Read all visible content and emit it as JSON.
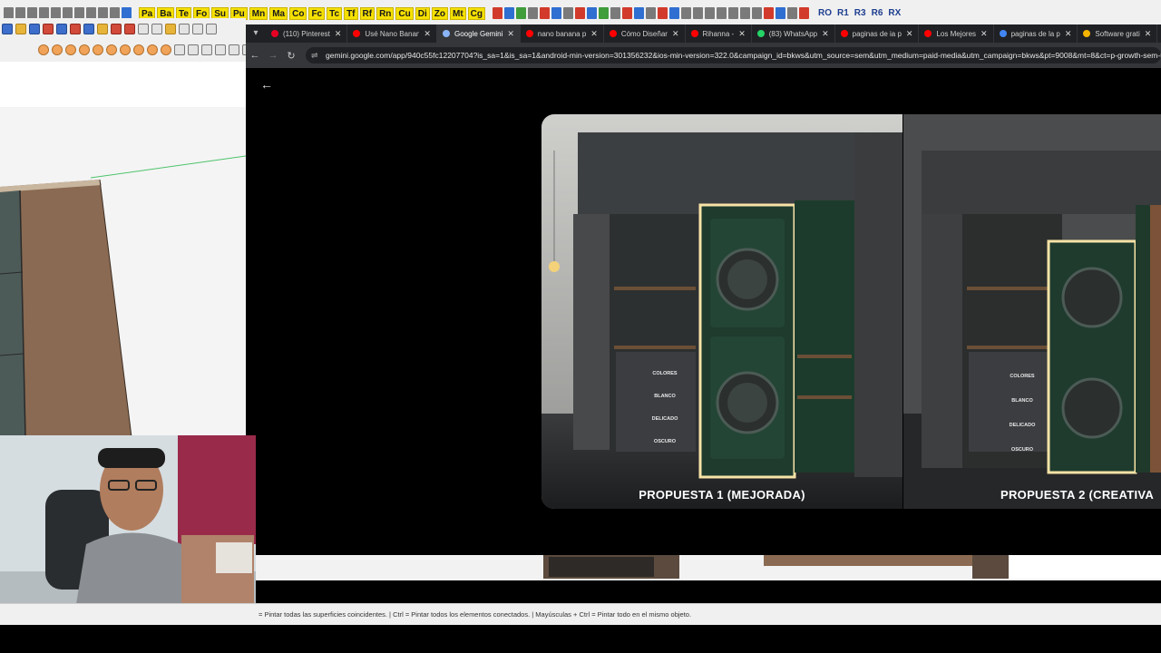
{
  "sketchup": {
    "toolbar_labels": [
      "Pa",
      "Ba",
      "Te",
      "Fo",
      "Su",
      "Pu",
      "Mn",
      "Ma",
      "Co",
      "Fc",
      "Tc",
      "Tf",
      "Rf",
      "Rn",
      "Cu",
      "Di",
      "Zo",
      "Mt",
      "Cg"
    ],
    "toolbar_right_labels": [
      "RO",
      "R1",
      "R3",
      "R6",
      "RX"
    ],
    "status_text": "= Pintar todas las superficies coincidentes.  |  Ctrl = Pintar todos los elementos conectados.  |  Mayúsculas + Ctrl = Pintar todo en el mismo objeto."
  },
  "browser": {
    "tabs": [
      {
        "title": "(110) Pinterest",
        "favicon_color": "#e60023",
        "active": false
      },
      {
        "title": "Usé Nano Banana",
        "favicon_color": "#ff0000",
        "active": false
      },
      {
        "title": "Google Gemini",
        "favicon_color": "#8ab4f8",
        "active": true
      },
      {
        "title": "nano banana p",
        "favicon_color": "#ff0000",
        "active": false
      },
      {
        "title": "Cómo Diseñar",
        "favicon_color": "#ff0000",
        "active": false
      },
      {
        "title": "Rihanna -",
        "favicon_color": "#ff0000",
        "active": false
      },
      {
        "title": "(83) WhatsApp",
        "favicon_color": "#25d366",
        "active": false
      },
      {
        "title": "paginas de ia p",
        "favicon_color": "#ff0000",
        "active": false
      },
      {
        "title": "Los Mejores",
        "favicon_color": "#ff0000",
        "active": false
      },
      {
        "title": "paginas de la p",
        "favicon_color": "#4285f4",
        "active": false
      },
      {
        "title": "Software grati",
        "favicon_color": "#f4b400",
        "active": false
      },
      {
        "title": "El m",
        "favicon_color": "#ffffff",
        "active": false
      }
    ],
    "url": "gemini.google.com/app/940c55fc12207704?is_sa=1&is_sa=1&android-min-version=301356232&ios-min-version=322.0&campaign_id=bkws&utm_source=sem&utm_medium=paid-media&utm_campaign=bkws&pt=9008&mt=8&ct=p-growth-sem-bkws&gclsrc",
    "gallery": [
      {
        "caption": "PROPUESTA 1 (MEJORADA)",
        "drawer_labels": [
          "COLORES",
          "BLANCO",
          "DELICADO",
          "OSCURO"
        ]
      },
      {
        "caption": "PROPUESTA 2 (CREATIVA",
        "drawer_labels": [
          "COLORES",
          "BLANCO",
          "DELICADO",
          "OSCURO"
        ]
      }
    ]
  },
  "colors": {
    "cabinet_green": "#1f3a2b",
    "wood": "#8a6a52",
    "led": "#f7e3a6"
  }
}
